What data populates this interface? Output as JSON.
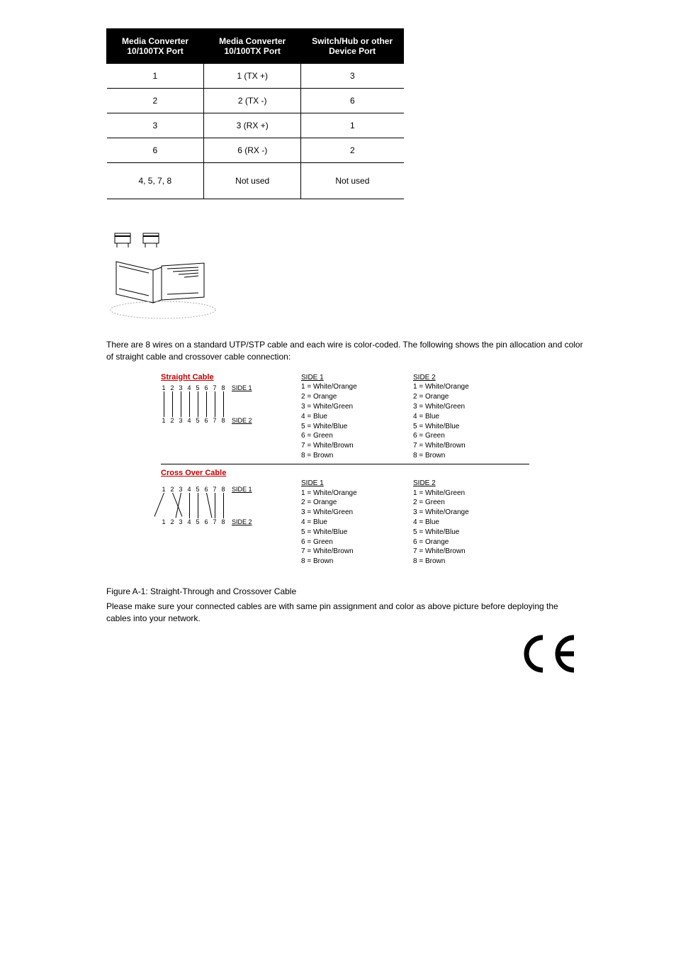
{
  "table": {
    "headers": [
      "Media Converter 10/100TX Port",
      "Media Converter 10/100TX Port",
      "Switch/Hub or other Device Port"
    ],
    "rows": [
      {
        "c0": "1",
        "c1": "1 (TX +)",
        "c2": "3"
      },
      {
        "c0": "2",
        "c1": "2 (TX -)",
        "c2": "6"
      },
      {
        "c0": "3",
        "c1": "3 (RX +)",
        "c2": "1"
      },
      {
        "c0": "6",
        "c1": "6 (RX -)",
        "c2": "2"
      },
      {
        "c0": "4, 5, 7, 8",
        "c1": "Not used",
        "c2": "Not used"
      }
    ]
  },
  "paragraph1": "There are 8 wires on a standard UTP/STP cable and each wire is color-coded. The following shows the pin allocation and color of straight cable and crossover cable connection:",
  "wiring": {
    "straight_title": "Straight Cable",
    "cross_title": "Cross Over Cable",
    "side1_label": "SIDE 1",
    "side2_label": "SIDE 2",
    "pins": [
      "1",
      "2",
      "3",
      "4",
      "5",
      "6",
      "7",
      "8"
    ],
    "side1_tag": "SIDE 1",
    "side2_tag": "SIDE 2",
    "straight_side1": [
      "1 = White/Orange",
      "2 = Orange",
      "3 = White/Green",
      "4 = Blue",
      "5 = White/Blue",
      "6 = Green",
      "7 = White/Brown",
      "8 = Brown"
    ],
    "straight_side2": [
      "1 = White/Orange",
      "2 = Orange",
      "3 = White/Green",
      "4 = Blue",
      "5 = White/Blue",
      "6 = Green",
      "7 = White/Brown",
      "8 = Brown"
    ],
    "cross_side1": [
      "1 = White/Orange",
      "2 = Orange",
      "3 = White/Green",
      "4 = Blue",
      "5 = White/Blue",
      "6 = Green",
      "7 = White/Brown",
      "8 = Brown"
    ],
    "cross_side2": [
      "1 = White/Green",
      "2 = Green",
      "3 = White/Orange",
      "4 = Blue",
      "5 = White/Blue",
      "6 = Orange",
      "7 = White/Brown",
      "8 = Brown"
    ]
  },
  "figure_label": "Figure A-1: Straight-Through and Crossover Cable",
  "paragraph2": "Please make sure your connected cables are with same pin assignment and color as above picture before deploying the cables into your network.",
  "ce_mark": "CE"
}
